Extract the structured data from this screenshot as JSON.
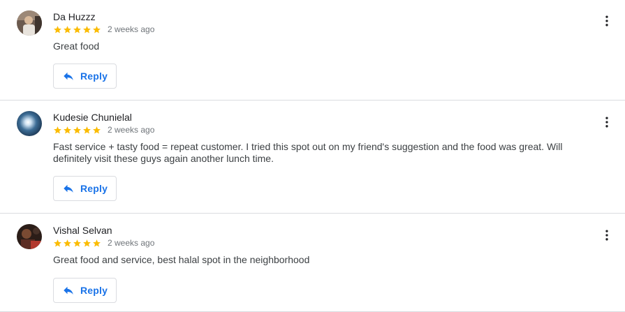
{
  "colors": {
    "star": "#fbbc04",
    "accent": "#1a73e8",
    "divider": "#dadce0",
    "secondary_text": "#70757a"
  },
  "reviews": [
    {
      "name": "Da Huzzz",
      "rating": 5,
      "date": "2 weeks ago",
      "text": "Great food",
      "reply_label": "Reply",
      "avatar_icon": "user-photo-avatar",
      "more_icon": "more-vert-icon"
    },
    {
      "name": "Kudesie Chunielal",
      "rating": 5,
      "date": "2 weeks ago",
      "text": "Fast service + tasty food = repeat customer. I tried this spot out on my friend's suggestion and the food was great. Will definitely visit these guys again another lunch time.",
      "reply_label": "Reply",
      "avatar_icon": "user-photo-avatar",
      "more_icon": "more-vert-icon"
    },
    {
      "name": "Vishal Selvan",
      "rating": 5,
      "date": "2 weeks ago",
      "text": "Great food and service, best halal spot in the neighborhood",
      "reply_label": "Reply",
      "avatar_icon": "user-photo-avatar",
      "more_icon": "more-vert-icon"
    }
  ]
}
